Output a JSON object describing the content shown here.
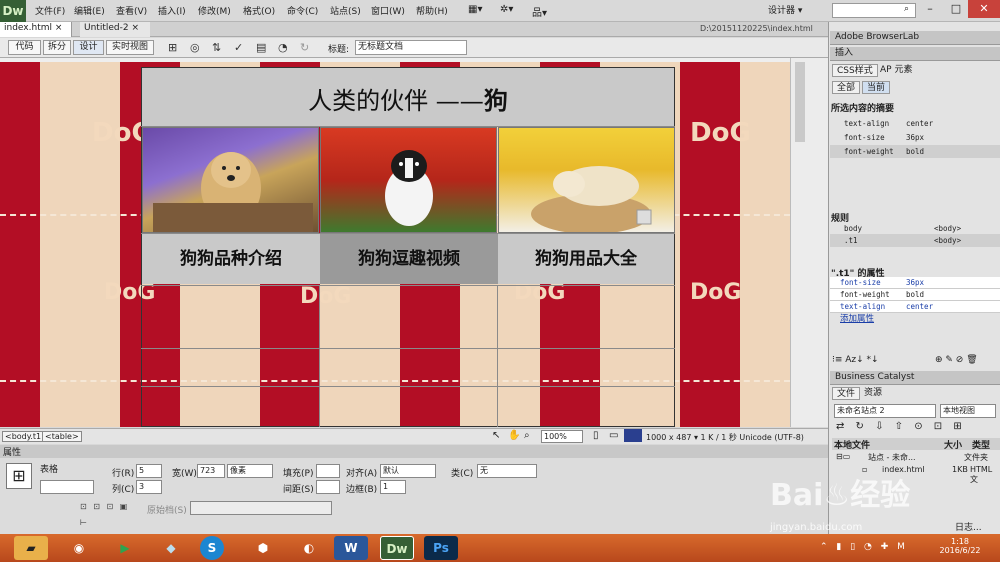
{
  "app": {
    "logo": "Dw",
    "workspace": "设计器 ▾"
  },
  "menu": [
    "文件(F)",
    "编辑(E)",
    "查看(V)",
    "插入(I)",
    "修改(M)",
    "格式(O)",
    "命令(C)",
    "站点(S)",
    "窗口(W)",
    "帮助(H)"
  ],
  "tabs": [
    {
      "label": "index.html"
    },
    {
      "label": "Untitled-2"
    }
  ],
  "doc_path": "D:\\20151120225\\index.html",
  "view_buttons": [
    "代码",
    "拆分",
    "设计",
    "实时视图"
  ],
  "title_field": {
    "label": "标题:",
    "value": "无标题文档"
  },
  "page": {
    "title_main": "人类的伙伴 ——",
    "title_bold": "狗",
    "nav": [
      "狗狗品种介绍",
      "狗狗逗趣视频",
      "狗狗用品大全"
    ],
    "bg_text": "DoG"
  },
  "status": {
    "tags": [
      "<body.t1>",
      "<table>"
    ],
    "zoom": "100%",
    "dims": "1000 x 487 ▾ 1 K / 1 秒 Unicode (UTF-8)"
  },
  "props": {
    "header": "属性",
    "type_label": "表格",
    "rows_label": "行(R)",
    "rows": "5",
    "cols_label": "列(C)",
    "cols": "3",
    "width_label": "宽(W)",
    "width": "723",
    "width_unit": "像素",
    "fill_label": "填充(P)",
    "spacing_label": "间距(S)",
    "align_label": "对齐(A)",
    "align": "默认",
    "border_label": "边框(B)",
    "border": "1",
    "class_label": "类(C)",
    "class": "无",
    "origin_label": "原始档(S)"
  },
  "right_panel": {
    "browserlab": "Adobe BrowserLab",
    "insert": "插入",
    "css_tab": "CSS样式",
    "ap_tab": "AP 元素",
    "all_btn": "全部",
    "current_btn": "当前",
    "summary_title": "所选内容的摘要",
    "summary": [
      {
        "k": "text-align",
        "v": "center"
      },
      {
        "k": "font-size",
        "v": "36px"
      },
      {
        "k": "font-weight",
        "v": "bold"
      }
    ],
    "rules_title": "规则",
    "rules": [
      {
        "k": "body",
        "v": "<body>"
      },
      {
        "k": ".t1",
        "v": "<body>"
      }
    ],
    "props_title": "\".t1\" 的属性",
    "props": [
      {
        "k": "font-size",
        "v": "36px"
      },
      {
        "k": "font-weight",
        "v": "bold"
      },
      {
        "k": "text-align",
        "v": "center"
      }
    ],
    "add_prop": "添加属性",
    "bc": "Business Catalyst",
    "files_tab": "文件",
    "assets_tab": "资源",
    "site": "未命名站点 2",
    "view": "本地视图",
    "col_local": "本地文件",
    "col_size": "大小",
    "col_type": "类型",
    "tree": [
      {
        "name": "站点 - 未命...",
        "size": "",
        "type": "文件夹"
      },
      {
        "name": "index.html",
        "size": "1KB",
        "type": "HTML 文"
      }
    ],
    "log": "日志..."
  },
  "taskbar": {
    "time": "1:18",
    "date": "2016/6/22"
  },
  "watermark": {
    "main": "Bai♨经验",
    "sub": "jingyan.baidu.com"
  }
}
